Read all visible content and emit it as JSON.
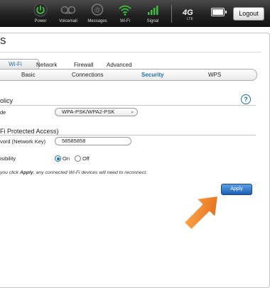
{
  "statusbar": {
    "items": [
      {
        "label": "Power",
        "icon": "power-icon"
      },
      {
        "label": "Voicemail",
        "icon": "voicemail-icon"
      },
      {
        "label": "Messages",
        "icon": "messages-icon"
      },
      {
        "label": "Wi-Fi",
        "icon": "wifi-icon"
      },
      {
        "label": "Signal",
        "icon": "signal-icon"
      }
    ],
    "network_badge": "4G LTE",
    "logout_label": "Logout"
  },
  "page": {
    "title": "s"
  },
  "main_tabs": [
    "Wi-Fi",
    "Network",
    "Firewall",
    "Advanced"
  ],
  "sub_tabs": [
    "Basic",
    "Connections",
    "Security",
    "WPS"
  ],
  "policy": {
    "heading": "olicy",
    "mode_label": "de",
    "mode_value": "WPA-PSK/WPA2-PSK"
  },
  "wpa": {
    "heading": "Fi Protected Access)",
    "password_label": "vord (Network Key)",
    "password_value": "58585858",
    "visibility_label": "isibility",
    "on_label": "On",
    "off_label": "Off"
  },
  "note": {
    "prefix": "you click ",
    "bold": "Apply",
    "suffix": ", any connected Wi-Fi devices will need to reconnect."
  },
  "apply_label": "Apply",
  "colors": {
    "accent": "#1a6fb0",
    "power_green": "#3fbf3f",
    "arrow_orange": "#f07a1a"
  }
}
